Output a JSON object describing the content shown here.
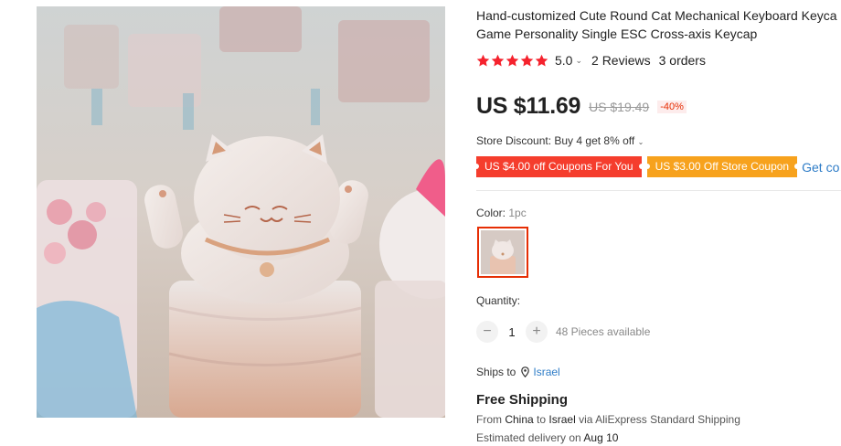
{
  "product": {
    "title_line1": "Hand-customized Cute Round Cat Mechanical Keyboard Keyca",
    "title_line2": "Game Personality Single ESC Cross-axis Keycap",
    "rating": "5.0",
    "reviews": "2 Reviews",
    "orders": "3 orders",
    "price": "US $11.69",
    "old_price": "US $19.49",
    "discount": "-40%",
    "store_discount": "Store Discount: Buy 4 get 8% off",
    "coupons": [
      "US $4.00 off Coupons For You",
      "US $3.00 Off Store Coupon"
    ],
    "get_coupons": "Get co",
    "color_label": "Color:",
    "color_value": "1pc",
    "quantity_label": "Quantity:",
    "quantity_minus": "−",
    "quantity": "1",
    "quantity_plus": "+",
    "available": "48 Pieces available",
    "ships_to_label": "Ships to",
    "ships_to_country": "Israel",
    "free_shipping": "Free Shipping",
    "ship_from_prefix": "From",
    "ship_from_origin": "China",
    "ship_from_to": "to",
    "ship_from_dest": "Israel",
    "ship_from_via": "via AliExpress Standard Shipping",
    "delivery_prefix": "Estimated delivery on",
    "delivery_date": "Aug 10"
  },
  "colors": {
    "star": "#f5222d",
    "price_red": "#e62e04",
    "coupon_red": "#f53d2d",
    "coupon_orange": "#f7a21d",
    "link_blue": "#2e7cc7"
  },
  "icons": [
    "star-icon",
    "chevron-down-icon",
    "location-pin-icon",
    "minus-icon",
    "plus-icon"
  ]
}
